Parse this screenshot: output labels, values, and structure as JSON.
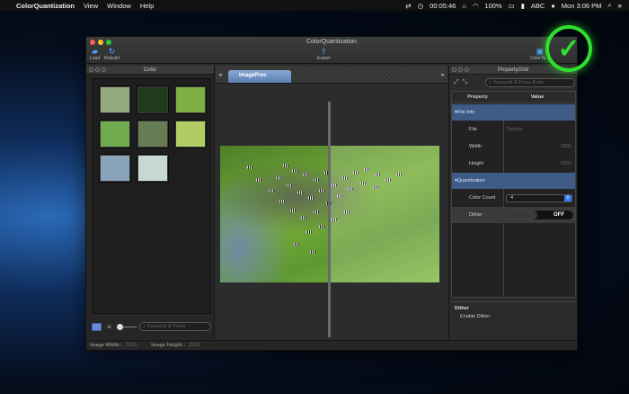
{
  "menubar": {
    "app_name": "ColorQuantization",
    "items": [
      "View",
      "Window",
      "Help"
    ],
    "timer": "00:05:46",
    "battery": "100%",
    "input_source": "ABC",
    "clock": "Mon 3:06 PM"
  },
  "window": {
    "title": "ColorQuantization",
    "toolbar": {
      "load": "Load",
      "rebuild": "Rebuild",
      "export": "Export",
      "colortable": "ColorTa..."
    }
  },
  "color_panel": {
    "title": "Color",
    "swatches": [
      "#93ab7f",
      "#223a1d",
      "#7fae45",
      "#72aa4f",
      "#667d54",
      "#b1cc62",
      "#8aa4bc",
      "#c7d7d4"
    ],
    "search_placeholder": "Keyword & Press"
  },
  "center": {
    "tab_label": "ImageProc"
  },
  "property_grid": {
    "title": "PropertyGrid",
    "search_placeholder": "Keyword & Press Enter",
    "header": {
      "property": "Property",
      "value": "Value"
    },
    "categories": {
      "file_info": "File Info",
      "quantization": "Quantization"
    },
    "rows": {
      "file": {
        "label": "File",
        "value": "Zebras"
      },
      "width": {
        "label": "Width",
        "value": "3300"
      },
      "height": {
        "label": "Height",
        "value": "2000"
      },
      "color_count": {
        "label": "Color Count",
        "value": "4"
      },
      "dither": {
        "label": "Dither",
        "value": "OFF"
      }
    },
    "help": {
      "title": "Dither",
      "desc": "Enable Dither"
    }
  },
  "statusbar": {
    "width_label": "Image Width :",
    "width_value": "3300",
    "height_label": "Image Height :",
    "height_value": "2000"
  },
  "colors": {
    "accent": "#3e5b86",
    "check": "#2ee02e"
  }
}
